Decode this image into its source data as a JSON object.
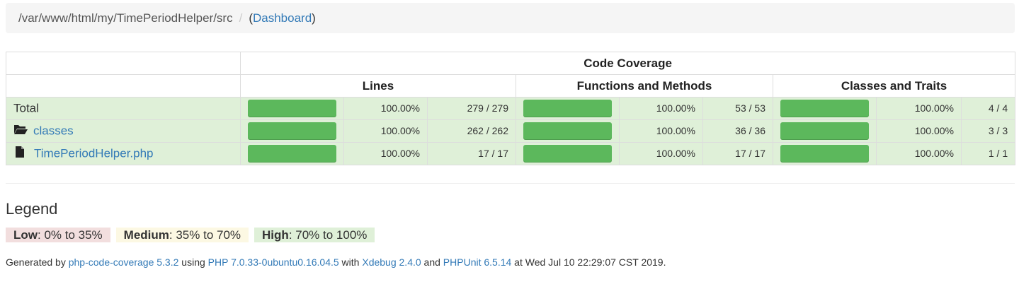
{
  "breadcrumb": {
    "path": "/var/www/html/my/TimePeriodHelper/src",
    "separator": "/",
    "dashboard_label": "Dashboard",
    "open_paren": "(",
    "close_paren": ")"
  },
  "table": {
    "header_main": "Code Coverage",
    "groups": [
      "Lines",
      "Functions and Methods",
      "Classes and Traits"
    ],
    "rows": [
      {
        "name": "Total",
        "icon": "none",
        "link": false,
        "lines_pct": "100.00%",
        "lines_count": "279 / 279",
        "func_pct": "100.00%",
        "func_count": "53 / 53",
        "class_pct": "100.00%",
        "class_count": "4 / 4"
      },
      {
        "name": "classes",
        "icon": "folder-open-icon",
        "link": true,
        "lines_pct": "100.00%",
        "lines_count": "262 / 262",
        "func_pct": "100.00%",
        "func_count": "36 / 36",
        "class_pct": "100.00%",
        "class_count": "3 / 3"
      },
      {
        "name": "TimePeriodHelper.php",
        "icon": "file-icon",
        "link": true,
        "lines_pct": "100.00%",
        "lines_count": "17 / 17",
        "func_pct": "100.00%",
        "func_count": "17 / 17",
        "class_pct": "100.00%",
        "class_count": "1 / 1"
      }
    ]
  },
  "legend": {
    "title": "Legend",
    "low_label": "Low",
    "low_range": ": 0% to 35%",
    "medium_label": "Medium",
    "medium_range": ": 35% to 70%",
    "high_label": "High",
    "high_range": ": 70% to 100%"
  },
  "footer": {
    "t1": "Generated by ",
    "l1": "php-code-coverage 5.3.2",
    "t2": " using ",
    "l2": "PHP 7.0.33-0ubuntu0.16.04.5",
    "t3": " with ",
    "l3": "Xdebug 2.4.0",
    "t4": " and ",
    "l4": "PHPUnit 6.5.14",
    "t5": " at Wed Jul 10 22:29:07 CST 2019."
  },
  "colors": {
    "success_bg": "#dff0d8",
    "bar_green": "#5cb85c",
    "low_bg": "#f2dede",
    "medium_bg": "#fcf8e3",
    "link": "#337ab7"
  }
}
